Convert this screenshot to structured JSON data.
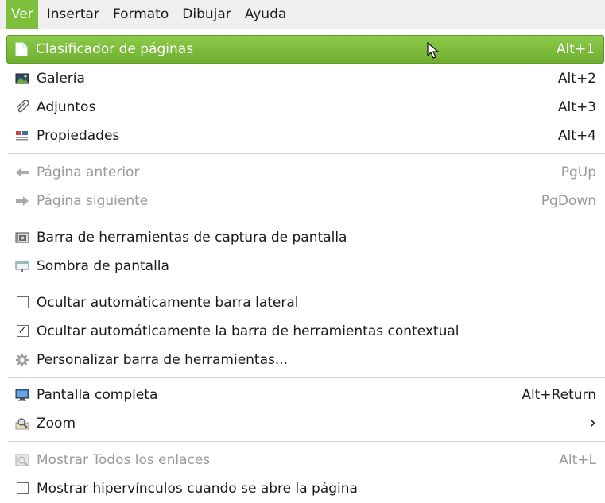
{
  "menubar": {
    "items": [
      {
        "label": "Ver",
        "active": true
      },
      {
        "label": "Insertar"
      },
      {
        "label": "Formato"
      },
      {
        "label": "Dibujar"
      },
      {
        "label": "Ayuda"
      }
    ]
  },
  "menu": {
    "items": [
      {
        "label": "Clasificador de páginas",
        "shortcut": "Alt+1",
        "icon": "page-sorter-icon",
        "highlight": true
      },
      {
        "label": "Galería",
        "shortcut": "Alt+2",
        "icon": "gallery-icon"
      },
      {
        "label": "Adjuntos",
        "shortcut": "Alt+3",
        "icon": "paperclip-icon"
      },
      {
        "label": "Propiedades",
        "shortcut": "Alt+4",
        "icon": "properties-icon"
      },
      {
        "label": "Página anterior",
        "shortcut": "PgUp",
        "icon": "arrow-left-icon",
        "disabled": true
      },
      {
        "label": "Página siguiente",
        "shortcut": "PgDown",
        "icon": "arrow-right-icon",
        "disabled": true
      },
      {
        "label": "Barra de herramientas de captura de pantalla",
        "shortcut": "",
        "icon": "camera-toolbar-icon"
      },
      {
        "label": "Sombra de pantalla",
        "shortcut": "",
        "icon": "screen-shade-icon"
      },
      {
        "label": "Ocultar automáticamente barra lateral",
        "shortcut": "",
        "icon": "checkbox-unchecked",
        "checked": false
      },
      {
        "label": "Ocultar automáticamente la barra de herramientas contextual",
        "shortcut": "",
        "icon": "checkbox-checked",
        "checked": true
      },
      {
        "label": "Personalizar barra de herramientas...",
        "shortcut": "",
        "icon": "gear-icon"
      },
      {
        "label": "Pantalla completa",
        "shortcut": "Alt+Return",
        "icon": "monitor-icon"
      },
      {
        "label": "Zoom",
        "shortcut": "›",
        "icon": "zoom-icon"
      },
      {
        "label": "Mostrar Todos los enlaces",
        "shortcut": "Alt+L",
        "icon": "links-icon",
        "disabled": true
      },
      {
        "label": "Mostrar hipervínculos cuando se abre la página",
        "shortcut": "",
        "icon": "checkbox-unchecked",
        "checked": false
      }
    ]
  },
  "colors": {
    "accent": "#7cbf3a",
    "disabled": "#9a9a9a"
  }
}
